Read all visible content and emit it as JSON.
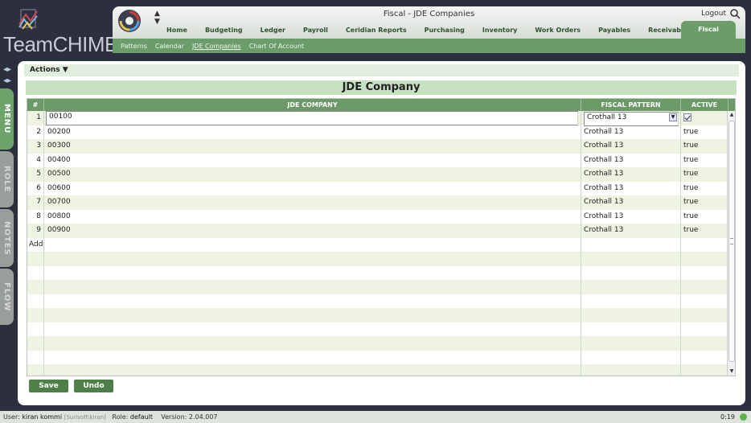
{
  "app": {
    "logo_text": "TeamCHIMES",
    "window_title": "Fiscal - JDE Companies",
    "logout_label": "Logout"
  },
  "nav": {
    "items": [
      "Home",
      "Budgeting",
      "Ledger",
      "Payroll",
      "Ceridian Reports",
      "Purchasing",
      "Inventory",
      "Work Orders",
      "Payables",
      "Receivables"
    ],
    "active": "Fiscal"
  },
  "subnav": {
    "items": [
      "Patterns",
      "Calendar",
      "JDE Companies",
      "Chart Of Account"
    ],
    "active_index": 2
  },
  "sidebar": {
    "tabs": [
      "MENU",
      "ROLE",
      "NOTES",
      "FLOW"
    ]
  },
  "actions_label": "Actions ▼",
  "panel_title": "JDE Company",
  "grid": {
    "columns": [
      "#",
      "JDE COMPANY",
      "FISCAL PATTERN",
      "ACTIVE"
    ],
    "rows": [
      {
        "n": "1",
        "company": "00100",
        "pattern": "Crothall 13",
        "active": "true"
      },
      {
        "n": "2",
        "company": "00200",
        "pattern": "Crothall 13",
        "active": "true"
      },
      {
        "n": "3",
        "company": "00300",
        "pattern": "Crothall 13",
        "active": "true"
      },
      {
        "n": "4",
        "company": "00400",
        "pattern": "Crothall 13",
        "active": "true"
      },
      {
        "n": "5",
        "company": "00500",
        "pattern": "Crothall 13",
        "active": "true"
      },
      {
        "n": "6",
        "company": "00600",
        "pattern": "Crothall 13",
        "active": "true"
      },
      {
        "n": "7",
        "company": "00700",
        "pattern": "Crothall 13",
        "active": "true"
      },
      {
        "n": "8",
        "company": "00800",
        "pattern": "Crothall 13",
        "active": "true"
      },
      {
        "n": "9",
        "company": "00900",
        "pattern": "Crothall 13",
        "active": "true"
      }
    ],
    "add_label": "Add"
  },
  "buttons": {
    "save": "Save",
    "undo": "Undo"
  },
  "status": {
    "user_label": "User:",
    "user": "kiran kommi",
    "domain": "[Surisoft\\kiran]",
    "role_label": "Role:",
    "role": "default",
    "version_label": "Version:",
    "version": "2.04.007",
    "clock": "0:19"
  }
}
